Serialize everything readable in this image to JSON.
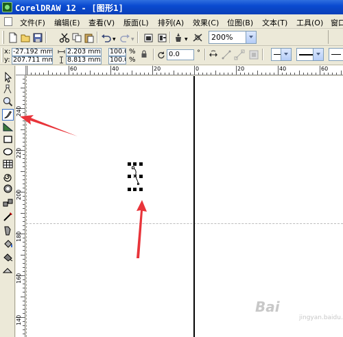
{
  "window": {
    "title": "CorelDRAW 12 - [图形1]"
  },
  "menu": {
    "items": [
      "文件(F)",
      "编辑(E)",
      "查看(V)",
      "版面(L)",
      "排列(A)",
      "效果(C)",
      "位图(B)",
      "文本(T)",
      "工具(O)",
      "窗口"
    ]
  },
  "toolbar": {
    "zoom_value": "200%",
    "icons": [
      "new-icon",
      "open-icon",
      "save-icon",
      "cut-icon",
      "copy-icon",
      "paste-icon",
      "undo-icon",
      "redo-icon",
      "import-icon",
      "export-icon",
      "application-launcher-icon",
      "welcome-screen-icon"
    ]
  },
  "properties": {
    "x_label": "x:",
    "y_label": "y:",
    "x_value": "-27.192 mm",
    "y_value": "207.711 mm",
    "width_value": "2.203 mm",
    "height_value": "8.813 mm",
    "scale_x": "100.0",
    "scale_y": "100.0",
    "scale_unit_x": "%",
    "scale_unit_y": "%",
    "rotation_value": "0.0",
    "rotation_unit": "°"
  },
  "ruler": {
    "top_labels": [
      "60",
      "40",
      "20",
      "0",
      "20",
      "40",
      "60"
    ],
    "left_labels": [
      "240",
      "220",
      "200",
      "180",
      "160",
      "140"
    ]
  },
  "toolbox": {
    "tools": [
      "pick-tool-icon",
      "shape-tool-icon",
      "zoom-tool-icon",
      "freehand-tool-icon",
      "smart-fill-tool-icon",
      "rectangle-tool-icon",
      "ellipse-tool-icon",
      "polygon-tool-icon",
      "spiral-tool-icon",
      "basic-shapes-tool-icon",
      "text-tool-icon",
      "interactive-blend-tool-icon",
      "eyedropper-tool-icon",
      "outline-tool-icon",
      "fill-tool-icon",
      "interactive-fill-tool-icon"
    ],
    "active_tool": "freehand-tool-icon"
  },
  "annotations": {
    "arrow_color": "#e8343a"
  },
  "watermark": {
    "text": "Bai",
    "sub": "jingyan.baidu.com"
  }
}
